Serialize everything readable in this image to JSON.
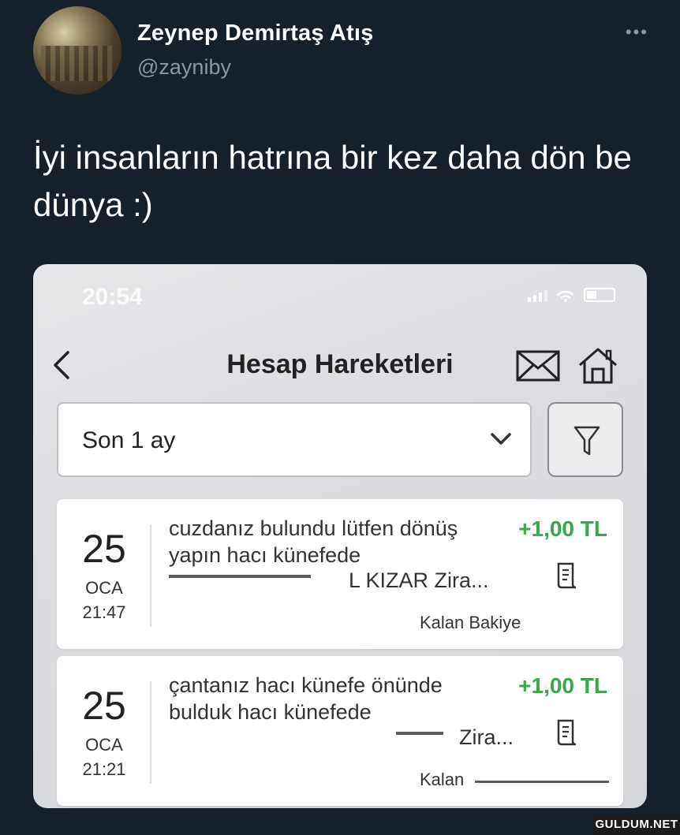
{
  "tweet": {
    "display_name": "Zeynep Demirtaş Atış",
    "handle": "@zayniby",
    "more_label": "•••",
    "text": "İyi insanların hatrına bir kez daha dön be dünya :)"
  },
  "screenshot": {
    "status_time": "20:54",
    "title": "Hesap Hareketleri",
    "period_select_value": "Son 1 ay",
    "transactions": [
      {
        "day": "25",
        "month": "OCA",
        "time": "21:47",
        "description": "cuzdanız bulundu lütfen dönüş yapın hacı künefede",
        "amount": "+1,00 TL",
        "account": "L KIZAR Zira...",
        "balance_label": "Kalan Bakiye"
      },
      {
        "day": "25",
        "month": "OCA",
        "time": "21:21",
        "description": "çantanız hacı künefe önünde bulduk hacı künefede",
        "amount": "+1,00 TL",
        "account": "Zira...",
        "balance_label": "Kalan"
      }
    ],
    "amount_color": "#3aa84a"
  },
  "watermark": "GULDUM.NET"
}
